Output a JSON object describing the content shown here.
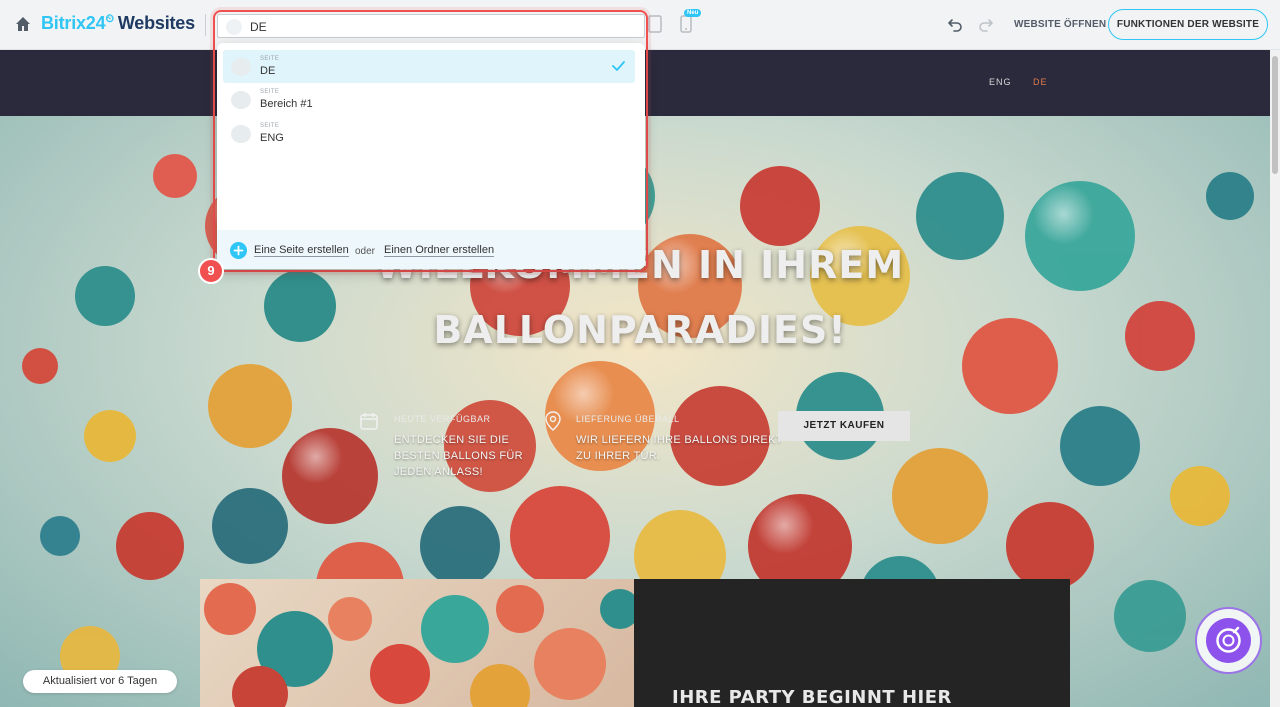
{
  "header": {
    "brand_main": "Bitrix24",
    "brand_suffix": "Websites",
    "new_badge": "Neu",
    "open_site_label": "WEBSITE ÖFFNEN",
    "site_functions_label": "FUNKTIONEN DER WEBSITE"
  },
  "picker": {
    "current_value": "DE",
    "pages": [
      {
        "kind": "SEITE",
        "name": "DE",
        "selected": true
      },
      {
        "kind": "SEITE",
        "name": "Bereich #1",
        "selected": false
      },
      {
        "kind": "SEITE",
        "name": "ENG",
        "selected": false
      }
    ],
    "footer": {
      "create_page": "Eine Seite erstellen",
      "or": "oder",
      "create_folder": "Einen Ordner erstellen"
    }
  },
  "step_badge": "9",
  "site": {
    "nav": {
      "lang_eng": "ENG",
      "lang_de": "DE"
    },
    "hero_line1": "WILLKOMMEN IN IHREM",
    "hero_line2": "BALLONPARADIES!",
    "features": [
      {
        "heading": "HEUTE VERFÜGBAR",
        "body_lines": [
          "ENTDECKEN SIE DIE",
          "BESTEN BALLONS FÜR",
          "JEDEN ANLASS!"
        ]
      },
      {
        "heading": "LIEFERUNG ÜBERALL",
        "body_lines": [
          "WIR LIEFERN IHRE BALLONS DIREKT",
          "ZU IHRER TÜR."
        ]
      }
    ],
    "buy_button": "JETZT KAUFEN",
    "party_title": "IHRE PARTY BEGINNT HIER"
  },
  "updated_label": "Aktualisiert vor 6 Tagen",
  "colors": {
    "accent": "#2fc6f6",
    "highlight": "#f0504f",
    "nav_bg": "#2b2a3d",
    "selected_row": "#dff4fb",
    "copilot": "#8e52ec"
  }
}
